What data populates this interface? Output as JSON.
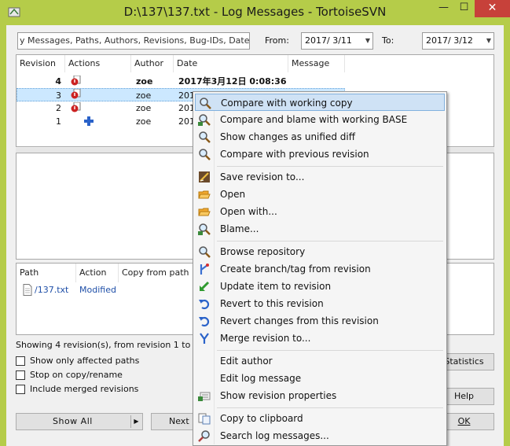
{
  "window": {
    "title": "D:\\137\\137.txt - Log Messages - TortoiseSVN",
    "minimize": "—",
    "maximize": "☐",
    "close": "✕"
  },
  "filter": {
    "search_value": "y Messages, Paths, Authors, Revisions, Bug-IDs, Date, Date",
    "from_label": "From:",
    "from_date": "2017/  3/11",
    "to_label": "To:",
    "to_date": "2017/  3/12"
  },
  "revisions": {
    "headers": [
      "Revision",
      "Actions",
      "Author",
      "Date",
      "Message"
    ],
    "rows": [
      {
        "revision": "4",
        "author": "zoe",
        "date": "2017年3月12日 0:08:36",
        "message": ""
      },
      {
        "revision": "3",
        "author": "zoe",
        "date": "201",
        "message": ""
      },
      {
        "revision": "2",
        "author": "zoe",
        "date": "201",
        "message": ""
      },
      {
        "revision": "1",
        "author": "zoe",
        "date": "201",
        "message": ""
      }
    ]
  },
  "paths": {
    "headers": [
      "Path",
      "Action",
      "Copy from path"
    ],
    "rows": [
      {
        "path": "/137.txt",
        "action": "Modified"
      }
    ]
  },
  "status": {
    "text": "Showing 4 revision(s), from revision 1 to revision 4"
  },
  "options": {
    "show_only_affected": "Show only affected paths",
    "stop_on_copy": "Stop on copy/rename",
    "include_merged": "Include merged revisions"
  },
  "buttons": {
    "show_all": "Show All",
    "next": "Next",
    "statistics": "Statistics",
    "help": "Help",
    "ok": "OK"
  },
  "context_menu": {
    "items": [
      {
        "label": "Compare with working copy",
        "icon": "magnifier-icon"
      },
      {
        "label": "Compare and blame with working BASE",
        "icon": "blame-compare-icon"
      },
      {
        "label": "Show changes as unified diff",
        "icon": "magnifier-icon"
      },
      {
        "label": "Compare with previous revision",
        "icon": "magnifier-icon"
      },
      {
        "label": "Save revision to...",
        "icon": "save-icon"
      },
      {
        "label": "Open",
        "icon": "open-folder-icon"
      },
      {
        "label": "Open with...",
        "icon": "open-folder-icon"
      },
      {
        "label": "Blame...",
        "icon": "blame-icon"
      },
      {
        "label": "Browse repository",
        "icon": "repo-browser-icon"
      },
      {
        "label": "Create branch/tag from revision",
        "icon": "branch-icon"
      },
      {
        "label": "Update item to revision",
        "icon": "update-arrow-icon"
      },
      {
        "label": "Revert to this revision",
        "icon": "revert-icon"
      },
      {
        "label": "Revert changes from this revision",
        "icon": "revert-icon"
      },
      {
        "label": "Merge revision to...",
        "icon": "merge-icon"
      },
      {
        "label": "Edit author",
        "icon": ""
      },
      {
        "label": "Edit log message",
        "icon": ""
      },
      {
        "label": "Show revision properties",
        "icon": "properties-icon"
      },
      {
        "label": "Copy to clipboard",
        "icon": "clipboard-icon"
      },
      {
        "label": "Search log messages...",
        "icon": "search-icon"
      }
    ]
  },
  "colors": {
    "window_frame": "#b5cc49",
    "selection": "#cce8ff",
    "menu_highlight": "#cfe2f5",
    "link_blue": "#1f4fa8",
    "close_red": "#c7413a"
  }
}
